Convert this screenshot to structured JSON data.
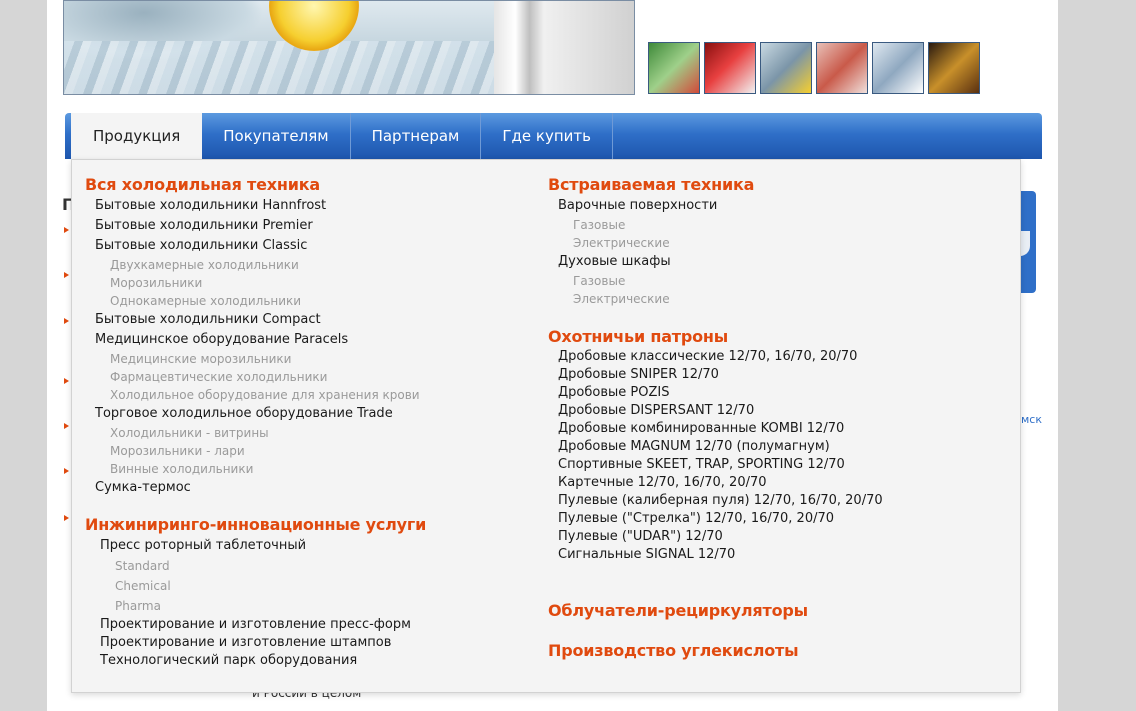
{
  "nav": {
    "items": [
      {
        "label": "Продукция",
        "active": true
      },
      {
        "label": "Покупателям",
        "active": false
      },
      {
        "label": "Партнерам",
        "active": false
      },
      {
        "label": "Где купить",
        "active": false
      }
    ]
  },
  "dropdown": {
    "left": {
      "sections": [
        {
          "title": "Вся холодильная техника",
          "items": [
            {
              "label": "Бытовые холодильники Hannfrost",
              "sub": []
            },
            {
              "label": "Бытовые холодильники Premier",
              "sub": []
            },
            {
              "label": "Бытовые холодильники Classic",
              "sub": [
                "Двухкамерные холодильники",
                "Морозильники",
                "Однокамерные холодильники"
              ]
            },
            {
              "label": "Бытовые холодильники Compact",
              "sub": []
            },
            {
              "label": "Медицинское оборудование Paracels",
              "sub": [
                "Медицинские морозильники",
                "Фармацевтические холодильники",
                "Холодильное оборудование для хранения крови"
              ]
            },
            {
              "label": "Торговое холодильное оборудование Trade",
              "sub": [
                "Холодильники - витрины",
                "Морозильники - лари",
                "Винные холодильники"
              ]
            },
            {
              "label": "Сумка-термос",
              "sub": []
            }
          ]
        },
        {
          "title": "Инжиниринго-инновационные услуги",
          "items": [
            {
              "label": "Пресс роторный таблеточный",
              "sub": [
                "Standard",
                "Chemical",
                "Pharma"
              ]
            },
            {
              "label": "Проектирование и изготовление пресс-форм",
              "sub": []
            },
            {
              "label": "Проектирование и изготовление штампов",
              "sub": []
            },
            {
              "label": "Технологический парк оборудования",
              "sub": []
            }
          ]
        }
      ]
    },
    "right": {
      "sections": [
        {
          "title": "Встраиваемая техника",
          "items": [
            {
              "label": "Варочные поверхности",
              "sub": [
                "Газовые",
                "Электрические"
              ]
            },
            {
              "label": "Духовые шкафы",
              "sub": [
                "Газовые",
                "Электрические"
              ]
            }
          ]
        },
        {
          "title": "Охотничьи патроны",
          "items": [
            {
              "label": "Дробовые классические 12/70, 16/70, 20/70",
              "sub": []
            },
            {
              "label": "Дробовые SNIPER 12/70",
              "sub": []
            },
            {
              "label": "Дробовые POZIS",
              "sub": []
            },
            {
              "label": "Дробовые DISPERSANT 12/70",
              "sub": []
            },
            {
              "label": "Дробовые комбинированные KOMBI 12/70",
              "sub": []
            },
            {
              "label": "Дробовые MAGNUM 12/70 (полумагнум)",
              "sub": []
            },
            {
              "label": "Спортивные SKEET, TRAP, SPORTING 12/70",
              "sub": []
            },
            {
              "label": "Картечные 12/70, 16/70, 20/70",
              "sub": []
            },
            {
              "label": "Пулевые (калиберная пуля) 12/70, 16/70, 20/70",
              "sub": []
            },
            {
              "label": "Пулевые (\"Стрелка\") 12/70, 16/70, 20/70",
              "sub": []
            },
            {
              "label": "Пулевые (\"UDAR\") 12/70",
              "sub": []
            },
            {
              "label": "Сигнальные SIGNAL 12/70",
              "sub": []
            }
          ]
        },
        {
          "title": "Облучатели-рециркуляторы",
          "items": []
        },
        {
          "title": "Производство углекислоты",
          "items": []
        }
      ]
    }
  },
  "background": {
    "left_heading_fragment": "П",
    "side_link_fragment": "мск",
    "bottom_text_fragment": "и России в целом"
  },
  "colors": {
    "accent": "#e04a0f",
    "nav_blue": "#2f6fc8",
    "dropdown_bg": "#f4f4f4"
  }
}
